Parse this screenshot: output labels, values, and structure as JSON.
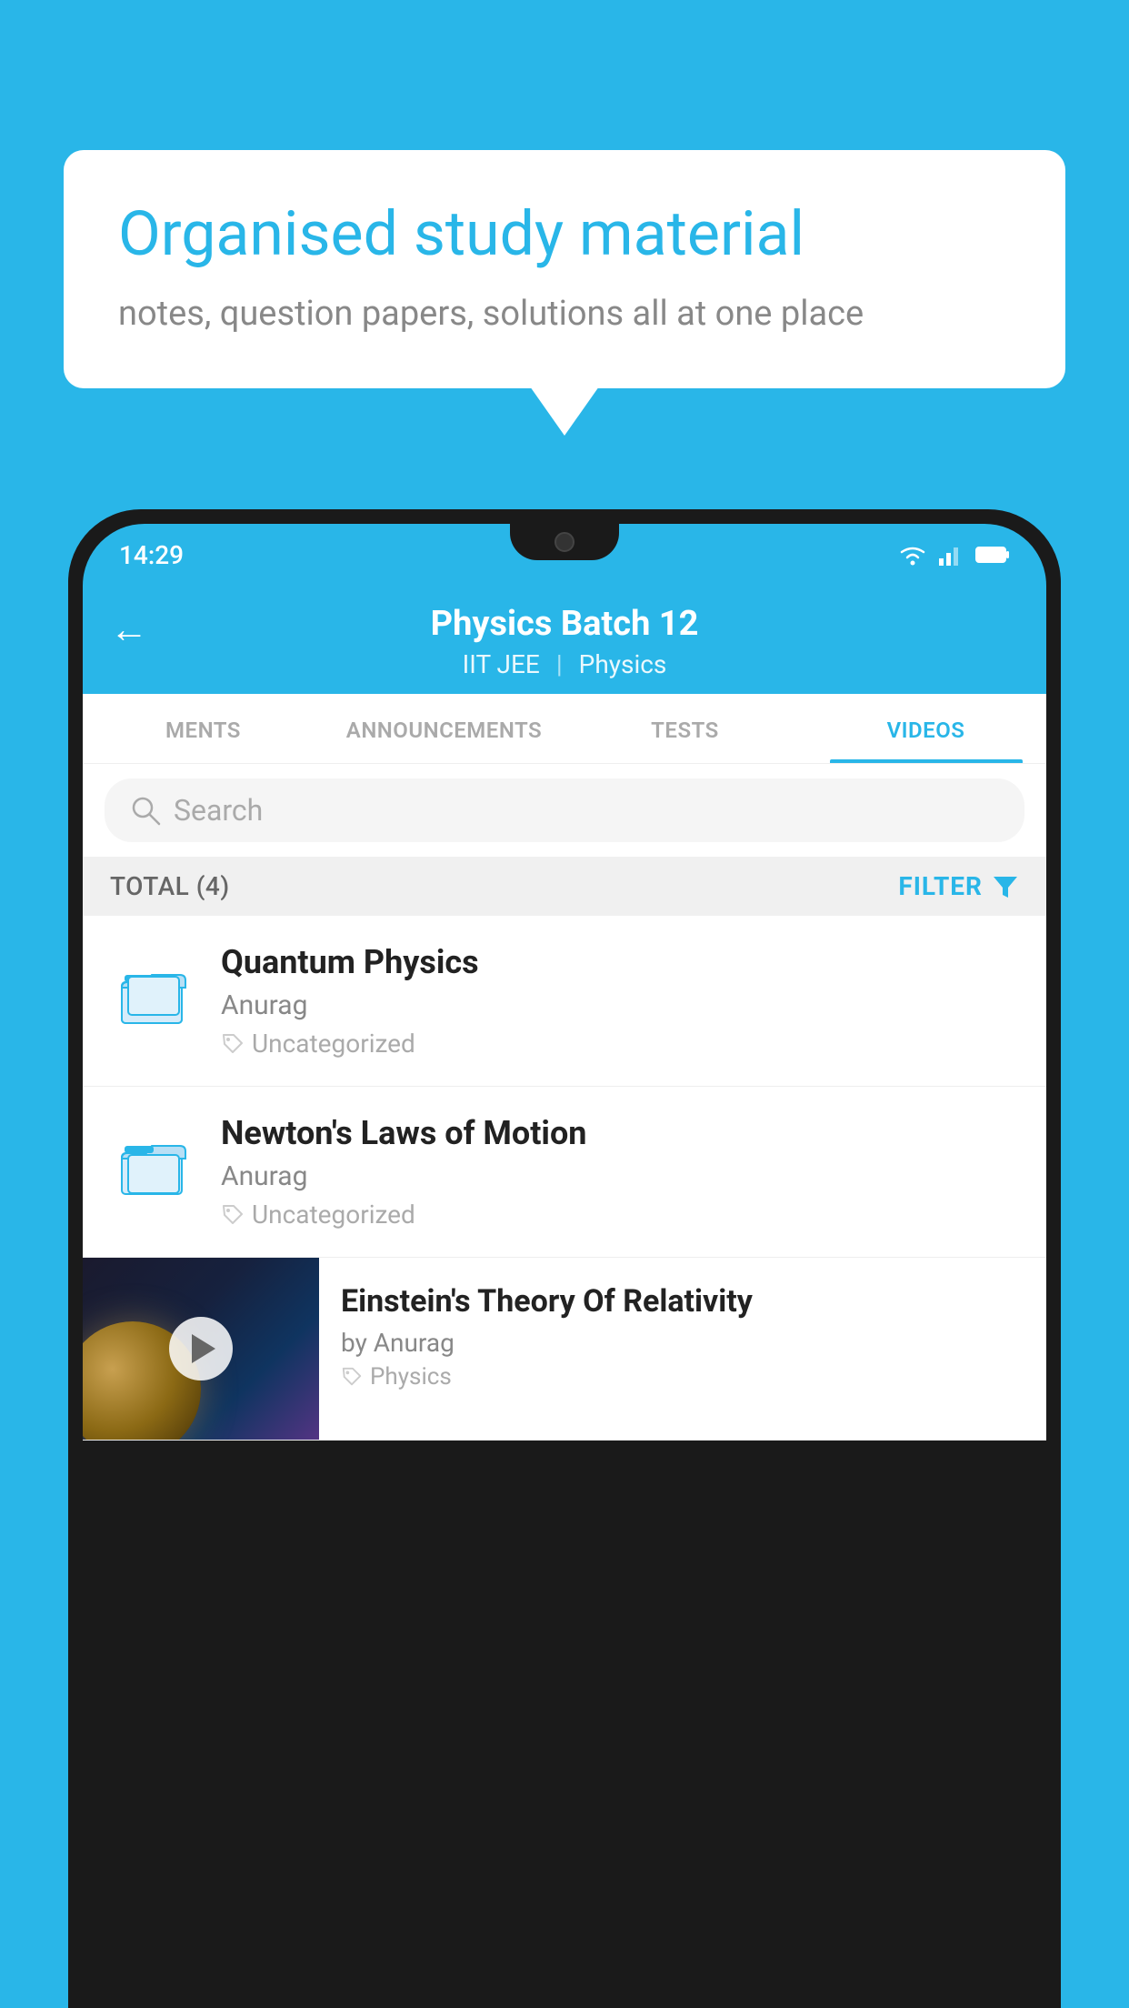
{
  "background_color": "#29b6e8",
  "speech_bubble": {
    "title": "Organised study material",
    "subtitle": "notes, question papers, solutions all at one place"
  },
  "status_bar": {
    "time": "14:29"
  },
  "app_header": {
    "title": "Physics Batch 12",
    "breadcrumb_1": "IIT JEE",
    "breadcrumb_2": "Physics",
    "back_label": "←"
  },
  "tabs": [
    {
      "label": "MENTS",
      "active": false
    },
    {
      "label": "ANNOUNCEMENTS",
      "active": false
    },
    {
      "label": "TESTS",
      "active": false
    },
    {
      "label": "VIDEOS",
      "active": true
    }
  ],
  "search": {
    "placeholder": "Search"
  },
  "filter_bar": {
    "total_label": "TOTAL (4)",
    "filter_label": "FILTER"
  },
  "videos": [
    {
      "title": "Quantum Physics",
      "author": "Anurag",
      "tag": "Uncategorized",
      "has_thumbnail": false
    },
    {
      "title": "Newton's Laws of Motion",
      "author": "Anurag",
      "tag": "Uncategorized",
      "has_thumbnail": false
    },
    {
      "title": "Einstein's Theory Of Relativity",
      "author": "by Anurag",
      "tag": "Physics",
      "has_thumbnail": true
    }
  ]
}
